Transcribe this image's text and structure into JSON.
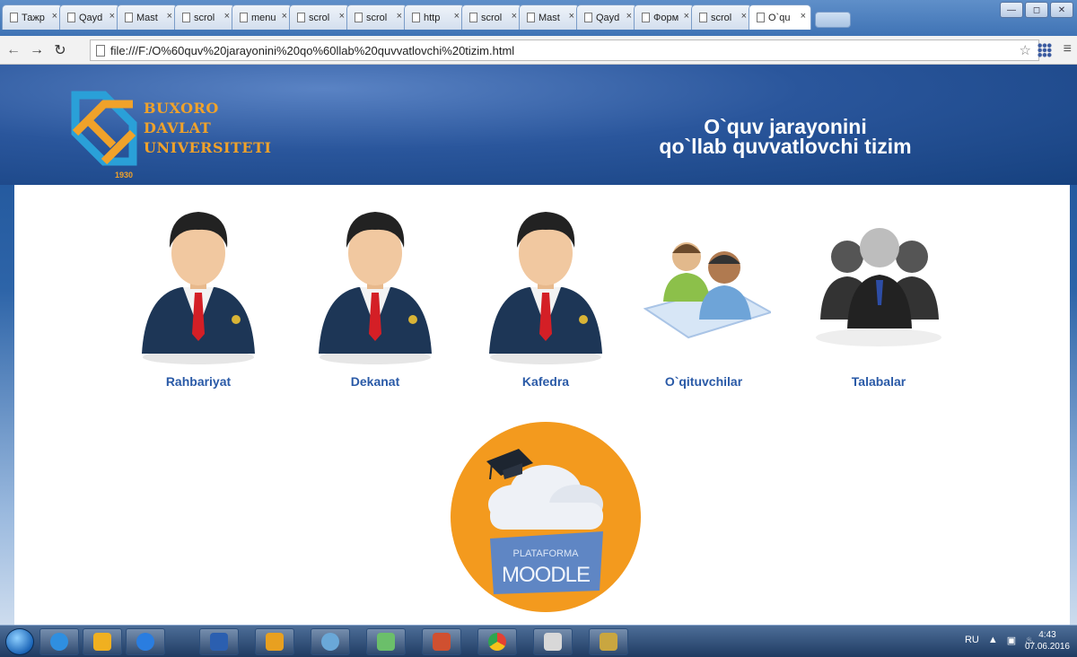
{
  "browser": {
    "tabs": [
      {
        "label": "Тажр"
      },
      {
        "label": "Qayd"
      },
      {
        "label": "Mast"
      },
      {
        "label": "scrol"
      },
      {
        "label": "menu"
      },
      {
        "label": "scrol"
      },
      {
        "label": "scrol"
      },
      {
        "label": "http"
      },
      {
        "label": "scrol"
      },
      {
        "label": "Mast"
      },
      {
        "label": "Qayd"
      },
      {
        "label": "Форм"
      },
      {
        "label": "scrol"
      },
      {
        "label": "O`qu",
        "active": true
      }
    ],
    "close_glyph": "×",
    "url": "file:///F:/O%60quv%20jarayonini%20qo%60llab%20quvvatlovchi%20tizim.html"
  },
  "header": {
    "logo_lines": [
      "BUXORO",
      "DAVLAT",
      "UNIVERSITETI"
    ],
    "logo_year": "1930",
    "title_line1": "O`quv jarayonini",
    "title_line2": "qo`llab quvvatlovchi tizim"
  },
  "menu": [
    {
      "label": "Rahbariyat",
      "icon": "businessman-icon"
    },
    {
      "label": "Dekanat",
      "icon": "businessman-icon"
    },
    {
      "label": "Kafedra",
      "icon": "businessman-icon"
    },
    {
      "label": "O`qituvchilar",
      "icon": "teachers-icon"
    },
    {
      "label": "Talabalar",
      "icon": "students-group-icon"
    }
  ],
  "moodle": {
    "line1": "PLATAFORMA",
    "line2": "MOODLE"
  },
  "taskbar": {
    "language": "RU",
    "time": "4:43",
    "date": "07.06.2016"
  },
  "colors": {
    "accent_link": "#2a5aa7",
    "logo_orange": "#f0a22a",
    "moodle_orange": "#f39a1e"
  }
}
